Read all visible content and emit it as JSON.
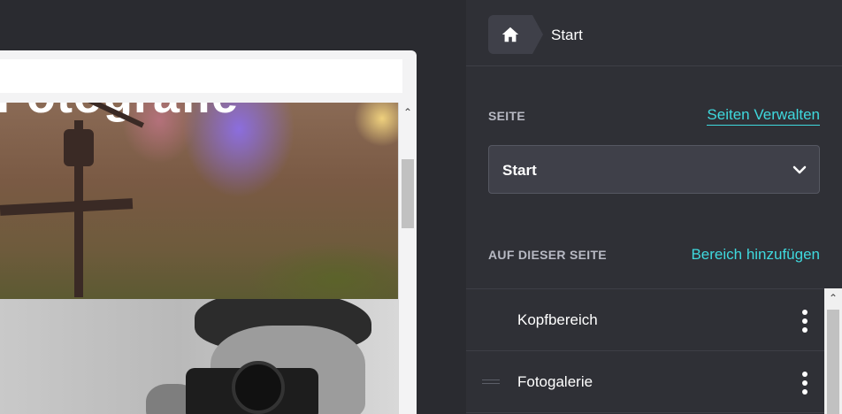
{
  "breadcrumb": {
    "home_icon": "home-icon",
    "current": "Start"
  },
  "page_section": {
    "label": "SEITE",
    "manage_link": "Seiten Verwalten",
    "select_value": "Start",
    "select_icon": "chevron-down-icon"
  },
  "on_page": {
    "label": "AUF DIESER SEITE",
    "add_link": "Bereich hinzufügen",
    "items": [
      {
        "label": "Kopfbereich",
        "menu_icon": "more-vertical-icon"
      },
      {
        "label": "Fotogalerie",
        "menu_icon": "more-vertical-icon",
        "drag_icon": "drag-handle-icon"
      }
    ]
  },
  "colors": {
    "panel_bg": "#2f3036",
    "accent": "#3fd9de",
    "field_bg": "#3f4049"
  }
}
